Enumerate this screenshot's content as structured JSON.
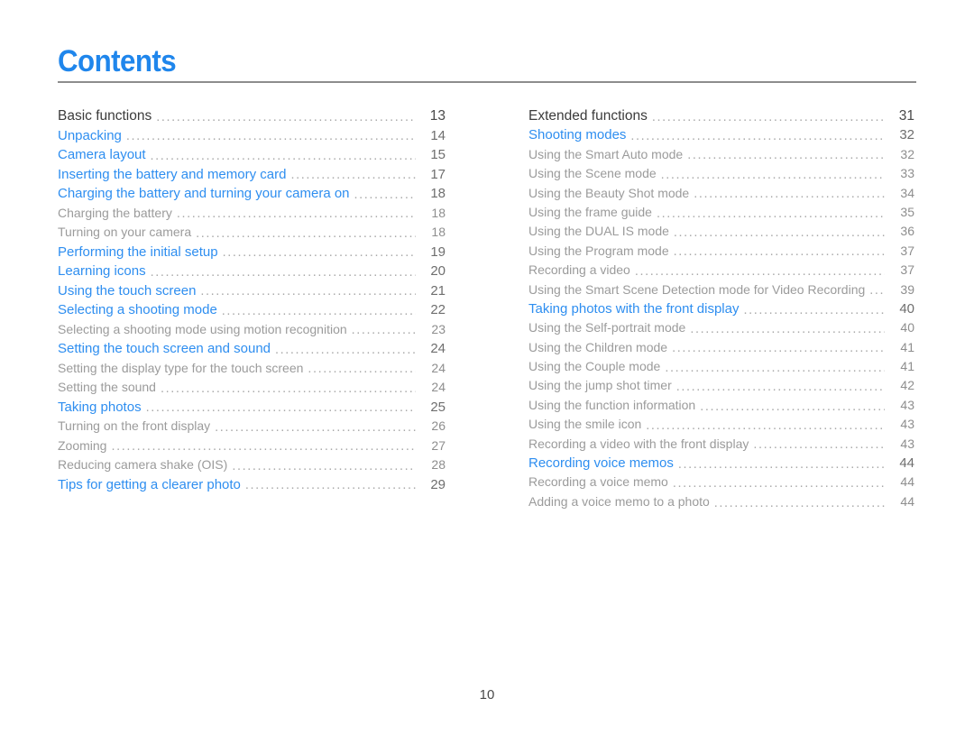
{
  "document": {
    "title": "Contents",
    "page_number": "10",
    "accent_color": "#2e8ef0",
    "rule_color": "#8d8d8d",
    "section_color": "#3b3b3b",
    "sub_color": "#9b9b9b"
  },
  "columns": {
    "left": {
      "entries": [
        {
          "label": "Basic functions",
          "page": "13",
          "type": "section"
        },
        {
          "label": "Unpacking",
          "page": "14",
          "type": "link"
        },
        {
          "label": "Camera layout",
          "page": "15",
          "type": "link"
        },
        {
          "label": "Inserting the battery and memory card",
          "page": "17",
          "type": "link"
        },
        {
          "label": "Charging the battery and turning your camera on",
          "page": "18",
          "type": "link"
        },
        {
          "label": "Charging the battery",
          "page": "18",
          "type": "sub"
        },
        {
          "label": "Turning on your camera",
          "page": "18",
          "type": "sub"
        },
        {
          "label": "Performing the initial setup",
          "page": "19",
          "type": "link"
        },
        {
          "label": "Learning icons",
          "page": "20",
          "type": "link"
        },
        {
          "label": "Using the touch screen",
          "page": "21",
          "type": "link"
        },
        {
          "label": "Selecting a shooting mode",
          "page": "22",
          "type": "link"
        },
        {
          "label": "Selecting a shooting mode using motion recognition",
          "page": "23",
          "type": "sub"
        },
        {
          "label": "Setting the touch screen and sound",
          "page": "24",
          "type": "link"
        },
        {
          "label": "Setting the display type for the touch screen",
          "page": "24",
          "type": "sub"
        },
        {
          "label": "Setting the sound",
          "page": "24",
          "type": "sub"
        },
        {
          "label": "Taking photos",
          "page": "25",
          "type": "link"
        },
        {
          "label": "Turning on the front display",
          "page": "26",
          "type": "sub"
        },
        {
          "label": "Zooming",
          "page": "27",
          "type": "sub"
        },
        {
          "label": "Reducing camera shake (OIS)",
          "page": "28",
          "type": "sub"
        },
        {
          "label": "Tips for getting a clearer photo",
          "page": "29",
          "type": "link"
        }
      ]
    },
    "right": {
      "entries": [
        {
          "label": "Extended functions",
          "page": "31",
          "type": "section"
        },
        {
          "label": "Shooting modes",
          "page": "32",
          "type": "link"
        },
        {
          "label": "Using the Smart Auto mode",
          "page": "32",
          "type": "sub"
        },
        {
          "label": "Using the Scene mode",
          "page": "33",
          "type": "sub"
        },
        {
          "label": "Using the Beauty Shot mode",
          "page": "34",
          "type": "sub"
        },
        {
          "label": "Using the frame guide",
          "page": "35",
          "type": "sub"
        },
        {
          "label": "Using the DUAL IS mode",
          "page": "36",
          "type": "sub"
        },
        {
          "label": "Using the Program mode",
          "page": "37",
          "type": "sub"
        },
        {
          "label": "Recording a video",
          "page": "37",
          "type": "sub"
        },
        {
          "label": "Using the Smart Scene Detection mode for Video Recording",
          "page": "39",
          "type": "sub"
        },
        {
          "label": "Taking photos with the front display",
          "page": "40",
          "type": "link"
        },
        {
          "label": "Using the Self-portrait mode",
          "page": "40",
          "type": "sub"
        },
        {
          "label": "Using the Children mode",
          "page": "41",
          "type": "sub"
        },
        {
          "label": "Using the Couple mode",
          "page": "41",
          "type": "sub"
        },
        {
          "label": "Using the jump shot timer",
          "page": "42",
          "type": "sub"
        },
        {
          "label": "Using the function information",
          "page": "43",
          "type": "sub"
        },
        {
          "label": "Using the smile icon",
          "page": "43",
          "type": "sub"
        },
        {
          "label": "Recording a video with the front display",
          "page": "43",
          "type": "sub"
        },
        {
          "label": "Recording voice memos",
          "page": "44",
          "type": "link"
        },
        {
          "label": "Recording a voice memo",
          "page": "44",
          "type": "sub"
        },
        {
          "label": "Adding a voice memo to a photo",
          "page": "44",
          "type": "sub"
        }
      ]
    }
  }
}
